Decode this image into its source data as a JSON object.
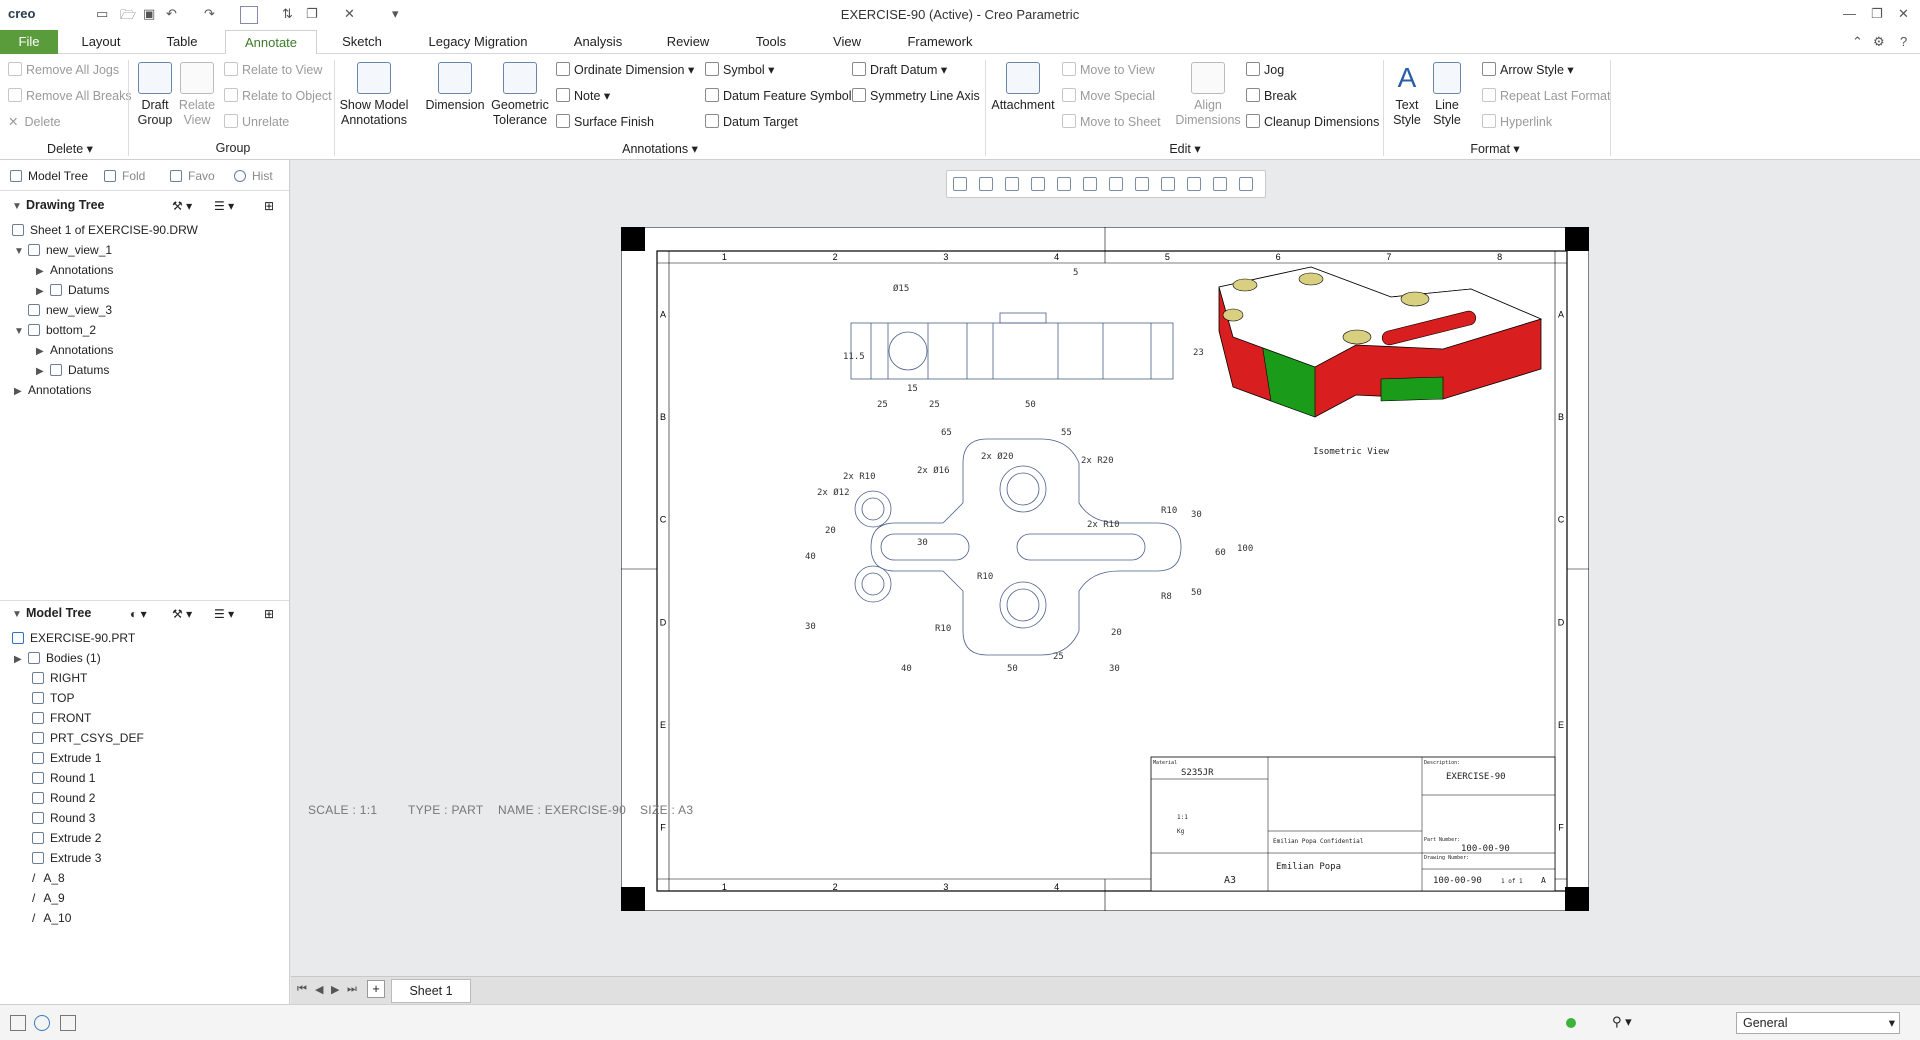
{
  "app": {
    "logo": "creo",
    "window_title": "EXERCISE-90 (Active) - Creo Parametric"
  },
  "tabs": [
    "File",
    "Layout",
    "Table",
    "Annotate",
    "Sketch",
    "Legacy Migration",
    "Analysis",
    "Review",
    "Tools",
    "View",
    "Framework"
  ],
  "ribbon": {
    "delete": {
      "remove_jogs": "Remove All Jogs",
      "remove_breaks": "Remove All Breaks",
      "delete": "Delete",
      "group_label": "Delete"
    },
    "group": {
      "draft_group": "Draft Group",
      "relate_view": "Relate View",
      "relate_to_view": "Relate to View",
      "relate_to_object": "Relate to Object",
      "unrelate": "Unrelate",
      "group_label": "Group"
    },
    "annotations": {
      "show_model": "Show Model Annotations",
      "dimension": "Dimension",
      "geometric_tolerance": "Geometric Tolerance",
      "ordinate": "Ordinate Dimension",
      "note": "Note",
      "surface_finish": "Surface Finish",
      "symbol": "Symbol",
      "datum_feature": "Datum Feature Symbol",
      "datum_target": "Datum Target",
      "draft_datum": "Draft Datum",
      "symmetry_line": "Symmetry Line Axis",
      "group_label": "Annotations"
    },
    "edit": {
      "attachment": "Attachment",
      "move_to_view": "Move to View",
      "move_special": "Move Special",
      "move_to_sheet": "Move to Sheet",
      "align_dimensions": "Align Dimensions",
      "jog": "Jog",
      "break": "Break",
      "cleanup": "Cleanup Dimensions",
      "group_label": "Edit"
    },
    "format": {
      "text_style": "Text Style",
      "line_style": "Line Style",
      "arrow_style": "Arrow Style",
      "repeat_last": "Repeat Last Format",
      "hyperlink": "Hyperlink",
      "group_label": "Format"
    }
  },
  "panel_tabs": [
    "Model Tree",
    "Fold",
    "Favo",
    "Hist"
  ],
  "drawing_tree": {
    "title": "Drawing Tree",
    "items": [
      "Sheet 1 of EXERCISE-90.DRW",
      "new_view_1",
      "Annotations",
      "Datums",
      "new_view_3",
      "bottom_2",
      "Annotations",
      "Datums",
      "Annotations"
    ]
  },
  "model_tree": {
    "title": "Model Tree",
    "items": [
      "EXERCISE-90.PRT",
      "Bodies (1)",
      "RIGHT",
      "TOP",
      "FRONT",
      "PRT_CSYS_DEF",
      "Extrude 1",
      "Round 1",
      "Round 2",
      "Round 3",
      "Extrude 2",
      "Extrude 3",
      "A_8",
      "A_9",
      "A_10"
    ]
  },
  "drawing": {
    "col_labels": [
      "1",
      "2",
      "3",
      "4",
      "5",
      "6",
      "7",
      "8"
    ],
    "row_labels": [
      "A",
      "B",
      "C",
      "D",
      "E",
      "F"
    ],
    "iso_caption": "Isometric View",
    "dims_top": [
      "Ø15",
      "5",
      "11.5",
      "23",
      "15",
      "25",
      "25",
      "50"
    ],
    "dims_bottom": [
      "65",
      "55",
      "2x Ø16",
      "2x Ø20",
      "2x R20",
      "2x R10",
      "2x Ø12",
      "2x R10",
      "R10",
      "30",
      "20",
      "40",
      "30",
      "R10",
      "R10",
      "R8",
      "30",
      "60",
      "100",
      "50",
      "20",
      "40",
      "50",
      "25",
      "30"
    ],
    "title_block": {
      "material_label": "Material",
      "material": "S235JR",
      "description_label": "Description:",
      "description": "EXERCISE-90",
      "confidential": "Emilian Popa Confidential",
      "legal_owner": "Emilian Popa",
      "part_number_label": "Part Number:",
      "part_number": "100-00-90",
      "drawing_number_label": "Drawing Number:",
      "drawing_number": "100-00-90",
      "sheet_size": "A3",
      "sheet": "1 of 1",
      "revision": "A",
      "scale": "1:1",
      "weight": "Kg"
    }
  },
  "info_bar": {
    "scale": "SCALE : 1:1",
    "type": "TYPE : PART",
    "name": "NAME : EXERCISE-90",
    "size": "SIZE : A3"
  },
  "sheet_tab": "Sheet 1",
  "status": {
    "filter": "General"
  }
}
